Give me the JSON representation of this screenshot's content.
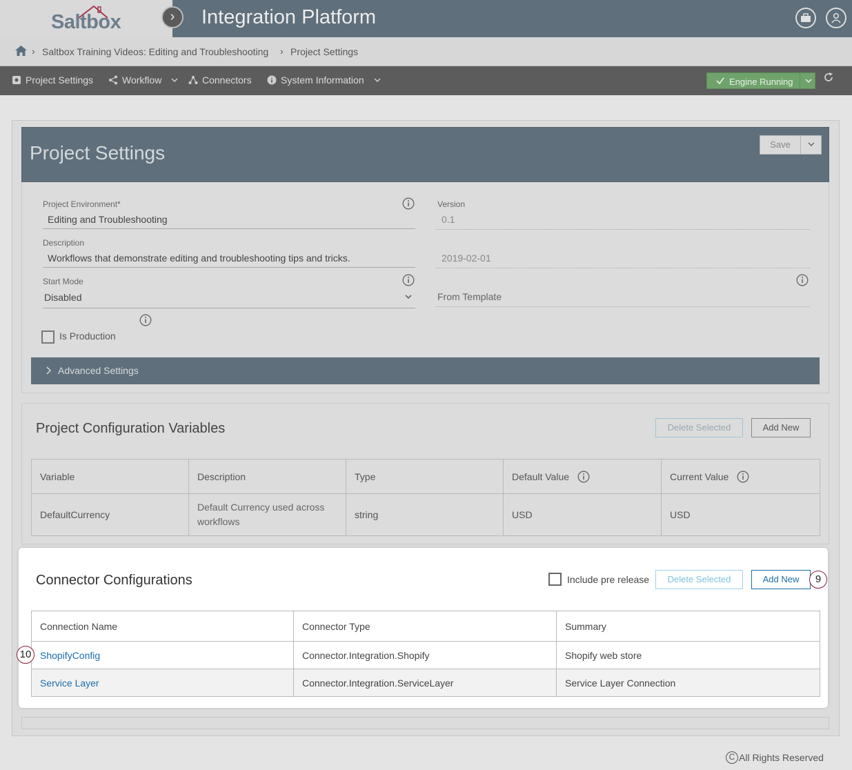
{
  "header": {
    "logo_text": "Saltbox",
    "app_title": "Integration Platform"
  },
  "breadcrumb": {
    "items": [
      "Saltbox Training Videos: Editing and Troubleshooting",
      "Project Settings"
    ]
  },
  "nav": {
    "items": [
      {
        "label": "Project Settings",
        "icon": "gear-icon"
      },
      {
        "label": "Workflow",
        "icon": "share-icon"
      },
      {
        "label": "Connectors",
        "icon": "network-icon"
      },
      {
        "label": "System Information",
        "icon": "info-icon"
      }
    ],
    "engine_label": "Engine Running"
  },
  "project_settings": {
    "title": "Project Settings",
    "save_label": "Save",
    "environment_label": "Project Environment*",
    "environment_value": "Editing and Troubleshooting",
    "version_label": "Version",
    "version_value": "0.1",
    "description_label": "Description",
    "description_value": "Workflows that demonstrate editing and troubleshooting tips and tricks.",
    "date_value": "2019-02-01",
    "start_mode_label": "Start Mode",
    "start_mode_value": "Disabled",
    "template_value": "From Template",
    "is_production_label": "Is Production",
    "advanced_label": "Advanced Settings"
  },
  "config_vars": {
    "title": "Project Configuration Variables",
    "delete_label": "Delete Selected",
    "add_label": "Add New",
    "columns": [
      "Variable",
      "Description",
      "Type",
      "Default Value",
      "Current Value"
    ],
    "rows": [
      [
        "DefaultCurrency",
        "Default Currency used across workflows",
        "string",
        "USD",
        "USD"
      ]
    ]
  },
  "connectors": {
    "title": "Connector Configurations",
    "prerelease_label": "Include pre release",
    "delete_label": "Delete Selected",
    "add_label": "Add New",
    "columns": [
      "Connection Name",
      "Connector Type",
      "Summary"
    ],
    "rows": [
      [
        "ShopifyConfig",
        "Connector.Integration.Shopify",
        "Shopify web store"
      ],
      [
        "Service Layer",
        "Connector.Integration.ServiceLayer",
        "Service Layer Connection"
      ]
    ]
  },
  "callouts": {
    "add_new": "9",
    "shopify": "10"
  },
  "footer": {
    "copyright_symbol": "C",
    "text": "All Rights Reserved"
  }
}
